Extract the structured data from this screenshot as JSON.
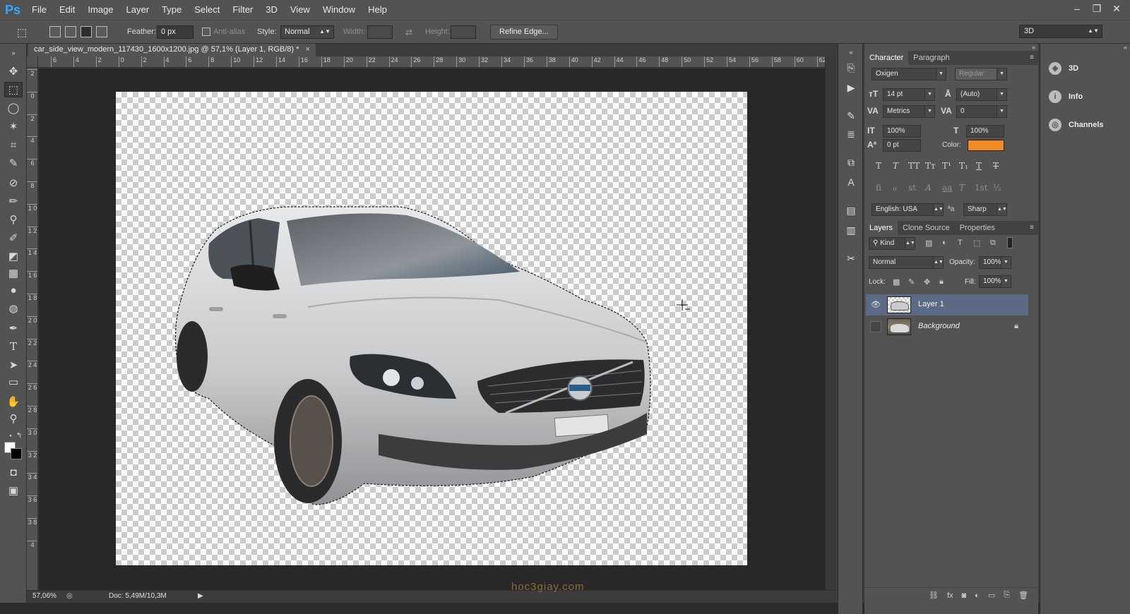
{
  "app": {
    "logo": "Ps"
  },
  "menu": [
    "File",
    "Edit",
    "Image",
    "Layer",
    "Type",
    "Select",
    "Filter",
    "3D",
    "View",
    "Window",
    "Help"
  ],
  "window_controls": {
    "minimize": "–",
    "restore": "❐",
    "close": "✕"
  },
  "options": {
    "feather_label": "Feather:",
    "feather_value": "0 px",
    "antialias_label": "Anti-alias",
    "style_label": "Style:",
    "style_value": "Normal",
    "width_label": "Width:",
    "height_label": "Height:",
    "refine_label": "Refine Edge...",
    "workspace_value": "3D"
  },
  "document": {
    "tab_title": "car_side_view_modern_117430_1600x1200.jpg @ 57,1% (Layer 1, RGB/8) *",
    "close": "×"
  },
  "ruler_h": [
    "6",
    "4",
    "2",
    "0",
    "2",
    "4",
    "6",
    "8",
    "10",
    "12",
    "14",
    "16",
    "18",
    "20",
    "22",
    "24",
    "26",
    "28",
    "30",
    "32",
    "34",
    "36",
    "38",
    "40",
    "42",
    "44",
    "46",
    "48",
    "50",
    "52",
    "54",
    "56",
    "58",
    "60",
    "62"
  ],
  "ruler_v": [
    "2",
    "0",
    "2",
    "4",
    "6",
    "8",
    "1 0",
    "1 2",
    "1 4",
    "1 6",
    "1 8",
    "2 0",
    "2 2",
    "2 4",
    "2 6",
    "2 8",
    "3 0",
    "3 2",
    "3 4",
    "3 6",
    "3 8",
    "4"
  ],
  "status": {
    "zoom": "57,06%",
    "doc_size": "Doc: 5,49M/10,3M",
    "watermark": "hoc3giay.com"
  },
  "character": {
    "tabs": [
      "Character",
      "Paragraph"
    ],
    "font_family": "Oxigen",
    "font_style": "Regular",
    "font_size": "14 pt",
    "leading": "(Auto)",
    "kerning": "Metrics",
    "tracking": "0",
    "vertical_scale": "100%",
    "horizontal_scale": "100%",
    "baseline_shift": "0 pt",
    "color_label": "Color:",
    "color_hex": "#f08a24",
    "format_buttons": [
      "T",
      "T",
      "TT",
      "Tт",
      "T¹",
      "T₁",
      "T",
      "T"
    ],
    "opentype_buttons": [
      "fi",
      "ℴ",
      "st",
      "A",
      "aa",
      "T",
      "1st",
      "½"
    ],
    "language": "English: USA",
    "aa_icon": "ªa",
    "antialias": "Sharp"
  },
  "layers": {
    "tabs": [
      "Layers",
      "Clone Source",
      "Properties"
    ],
    "filter_kind": "Kind",
    "blend_mode": "Normal",
    "opacity_label": "Opacity:",
    "opacity_value": "100%",
    "lock_label": "Lock:",
    "fill_label": "Fill:",
    "fill_value": "100%",
    "items": [
      {
        "name": "Layer 1",
        "visible": true,
        "selected": true
      },
      {
        "name": "Background",
        "visible": false,
        "selected": false,
        "locked": true
      }
    ]
  },
  "far_dock": [
    {
      "label": "3D",
      "icon": "cube-icon"
    },
    {
      "label": "Info",
      "icon": "info-icon"
    },
    {
      "label": "Channels",
      "icon": "channels-icon"
    }
  ]
}
